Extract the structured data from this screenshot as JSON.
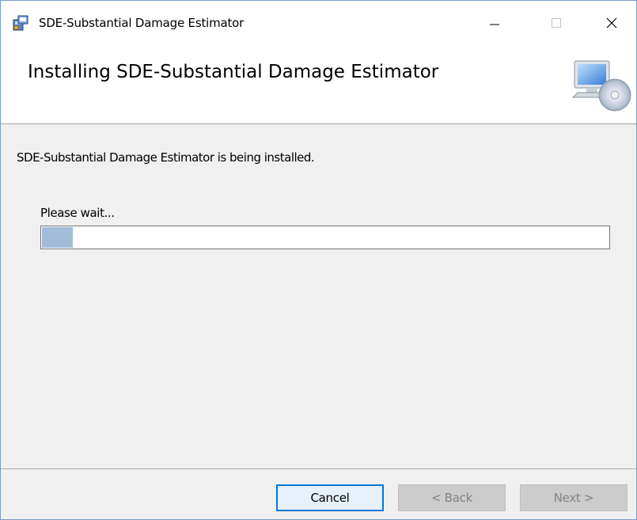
{
  "window": {
    "title": "SDE-Substantial Damage Estimator",
    "controls": {
      "minimize_icon": "minimize-icon",
      "maximize_icon": "maximize-icon",
      "close_icon": "close-icon"
    }
  },
  "header": {
    "title": "Installing SDE-Substantial Damage Estimator",
    "icon": "computer-cd-icon"
  },
  "body": {
    "status": "SDE-Substantial Damage Estimator is being installed.",
    "wait_label": "Please wait...",
    "progress_fraction": 0.055
  },
  "footer": {
    "cancel_label": "Cancel",
    "back_label": "< Back",
    "next_label": "Next >"
  },
  "colors": {
    "progress_fill": "#a3bcd8",
    "focus_border": "#0078d7"
  }
}
